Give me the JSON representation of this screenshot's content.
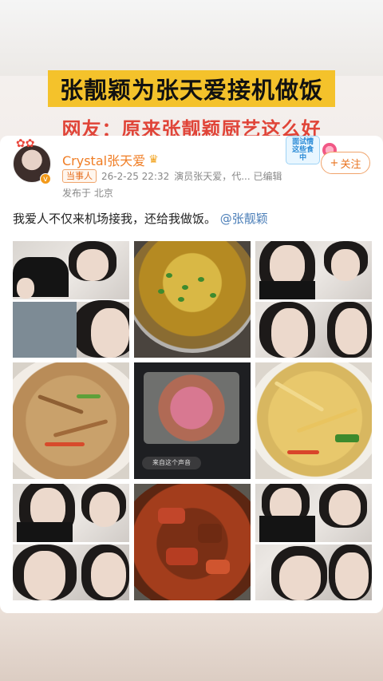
{
  "headline": "张靓颖为张天爱接机做饭",
  "subline": "网友：原来张靓颖厨艺这么好",
  "post": {
    "username": "Crystal张天爱",
    "badge": "当事人",
    "timestamp": "26-2-25 22:32",
    "source": "演员张天爱，代... 已编辑",
    "location": "发布于 北京",
    "text": "我爱人不仅来机场接我，还给我做饭。",
    "mention": "@张靓颖",
    "follow_label": "关注",
    "sticker_text": "面试情\n这些食中",
    "fish_comment": "来自这个声音"
  },
  "colors": {
    "accent_orange": "#f07d24",
    "headline_bg": "#f4c22b",
    "subline_red": "#e04438",
    "mention_blue": "#4c7fb8"
  },
  "icons": [
    "crown-icon",
    "verified-icon",
    "plus-icon"
  ]
}
